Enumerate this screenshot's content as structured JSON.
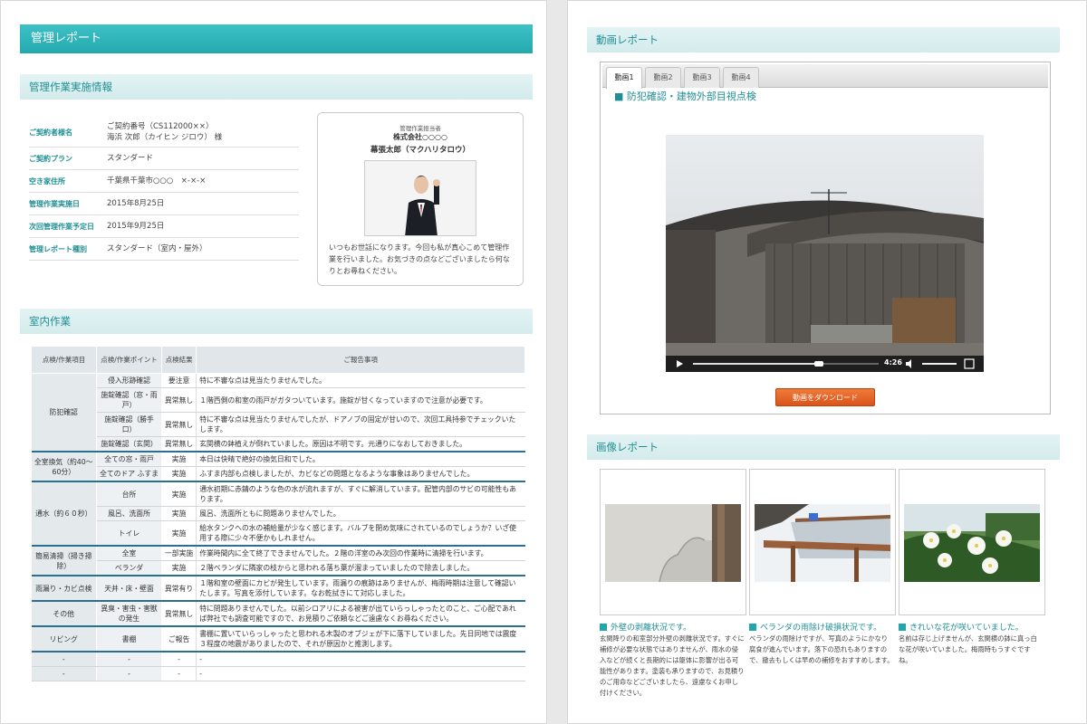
{
  "main_title": "管理レポート",
  "sections": {
    "info": "管理作業実施情報",
    "indoor": "室内作業",
    "video": "動画レポート",
    "image": "画像レポート"
  },
  "info_rows": [
    {
      "k": "ご契約者様名",
      "v1": "ご契約番号（CS112000××）",
      "v2": "海浜 次郎（カイヒン ジロウ） 様"
    },
    {
      "k": "ご契約プラン",
      "v1": "スタンダード",
      "v2": ""
    },
    {
      "k": "空き家住所",
      "v1": "千葉県千葉市○○○　×-×-×",
      "v2": ""
    },
    {
      "k": "管理作業実施日",
      "v1": "2015年8月25日",
      "v2": ""
    },
    {
      "k": "次回管理作業予定日",
      "v1": "2015年9月25日",
      "v2": ""
    },
    {
      "k": "管理レポート種別",
      "v1": "スタンダード（室内・屋外）",
      "v2": ""
    }
  ],
  "staff": {
    "role": "管理作業担当者",
    "company": "株式会社○○○○",
    "name": "幕張太郎（マクハリタロウ）",
    "message": "いつもお世話になります。今回も私が真心こめて管理作業を行いました。お気づきの点などございましたら何なりとお尋ねください。"
  },
  "table_headers": {
    "cat": "点検/作業項目",
    "pt": "点検/作業ポイント",
    "res": "点検結果",
    "rep": "ご報告事項"
  },
  "table_rows": [
    {
      "cat": "防犯確認",
      "span": 4,
      "pt": "侵入形跡確認",
      "res": "要注意",
      "rep": "特に不審な点は見当たりませんでした。"
    },
    {
      "pt": "施錠確認（窓・雨戸）",
      "res": "異常無し",
      "rep": "１階西側の和室の雨戸がガタついています。施錠が甘くなっていますので注意が必要です。"
    },
    {
      "pt": "施錠確認（勝手口）",
      "res": "異常無し",
      "rep": "特に不審な点は見当たりませんでしたが、ドアノブの固定が甘いので、次回工具持参でチェックいたします。"
    },
    {
      "pt": "施錠確認（玄関）",
      "res": "異常無し",
      "rep": "玄関横の鉢植えが倒れていました。原因は不明です。元通りになおしておきました。"
    },
    {
      "cat": "全室換気（約40〜60分）",
      "span": 2,
      "pt": "全ての窓・雨戸",
      "res": "実施",
      "rep": "本日は快晴で絶好の換気日和でした。",
      "hl": true
    },
    {
      "pt": "全てのドア ふすま",
      "res": "実施",
      "rep": "ふすま内部も点検しましたが、カビなどの問題となるような事象はありませんでした。"
    },
    {
      "cat": "通水（約６０秒）",
      "span": 3,
      "pt": "台所",
      "res": "実施",
      "rep": "通水初期に赤錆のような色の水が流れますが、すぐに解消しています。配管内部のサビの可能性もあります。",
      "hl": true
    },
    {
      "pt": "風呂、洗面所",
      "res": "実施",
      "rep": "風呂、洗面所ともに問題ありませんでした。"
    },
    {
      "pt": "トイレ",
      "res": "実施",
      "rep": "給水タンクへの水の補給量が少なく感じます。バルブを閉め気味にされているのでしょうか？いざ使用する際に少々不便かもしれません。"
    },
    {
      "cat": "簡易清掃（掃き掃除）",
      "span": 2,
      "pt": "全室",
      "res": "一部実施",
      "rep": "作業時間内に全て終了できませんでした。２階の洋室のみ次回の作業時に清掃を行います。",
      "hl": true
    },
    {
      "pt": "ベランダ",
      "res": "実施",
      "rep": "２階ベランダに隣家の枝からと思われる落ち葉が溜まっていましたので除去しました。"
    },
    {
      "cat": "雨漏り・カビ点検",
      "span": 1,
      "pt": "天井・床・壁面",
      "res": "異常有り",
      "rep": "１階和室の壁面にカビが発生しています。雨漏りの痕跡はありませんが、梅雨時期は注意して確認いたします。写真を添付しています。なお乾拭きにて対応しました。",
      "hl": true
    },
    {
      "cat": "その他",
      "span": 1,
      "pt": "異臭・害虫・害獣の発生",
      "res": "異常無し",
      "rep": "特に問題ありませんでした。以前シロアリによる被害が出ていらっしゃったとのこと、ご心配であれば弊社でも調査可能ですので、お見積りご依頼などご遠慮なくお尋ねください。",
      "hl": true
    },
    {
      "cat": "リビング",
      "span": 1,
      "pt": "書棚",
      "res": "ご報告",
      "rep": "書棚に置いていらっしゃったと思われる木製のオブジェが下に落下していました。先日同地では震度３程度の地震がありましたので、それが原因かと推測します。",
      "hl": true
    },
    {
      "cat": "-",
      "span": 1,
      "pt": "-",
      "res": "-",
      "rep": "-",
      "hl": true
    },
    {
      "cat": "-",
      "span": 1,
      "pt": "-",
      "res": "-",
      "rep": "-"
    }
  ],
  "video": {
    "tabs": [
      "動画1",
      "動画2",
      "動画3",
      "動画4"
    ],
    "title": "■ 防犯確認・建物外部目視点検",
    "time": "4:26",
    "download": "動画をダウンロード"
  },
  "images": [
    {
      "title": "外壁の剥離状況です。",
      "desc": "玄関降りの和室部分外壁の剥離状況です。すぐに補修が必要な状態ではありませんが、雨水の侵入などが続くと長期的には躯体に影響が出る可能性があります。塗装も承りますので、お見積りのご用命などございましたら、遠慮なくお申し付けください。"
    },
    {
      "title": "ベランダの雨除け破損状況です。",
      "desc": "ベランダの雨除けですが、写真のようにかなり腐食が進んでいます。落下の恐れもありますので、撤去もしくは早めの補修をおすすめします。"
    },
    {
      "title": "きれいな花が咲いていました。",
      "desc": "名前は存じ上げませんが、玄関横の鉢に真っ白な花が咲いていました。梅雨時もうすぐですね。"
    }
  ]
}
